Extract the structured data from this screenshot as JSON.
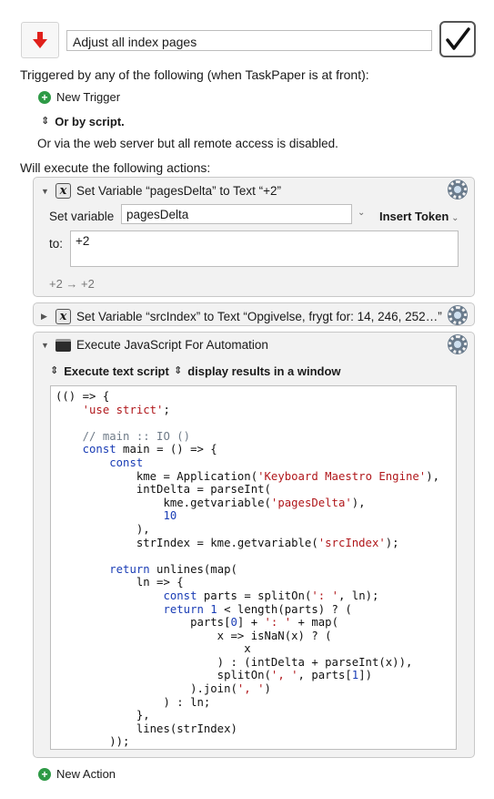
{
  "macro": {
    "name": "Adjust all index pages",
    "icon": "red-down-arrow-icon",
    "enabled_icon": "checkmark-icon"
  },
  "triggers": {
    "heading": "Triggered by any of the following (when TaskPaper is at front):",
    "new_trigger": "New Trigger",
    "by_script": "Or by script.",
    "web_server": "Or via the web server but all remote access is disabled."
  },
  "actions_heading": "Will execute the following actions:",
  "actions": [
    {
      "title": "Set Variable “pagesDelta” to Text “+2”",
      "set_variable_label": "Set variable",
      "variable_value": "pagesDelta",
      "insert_token": "Insert Token",
      "to_label": "to:",
      "to_value": "+2",
      "preview": "+2 → +2"
    },
    {
      "title": "Set Variable “srcIndex” to Text “Opgivelse, frygt for: 14, 246, 252…”"
    },
    {
      "title": "Execute JavaScript For Automation",
      "option1": "Execute text script",
      "option2": "display results in a window"
    }
  ],
  "new_action": "New Action",
  "colors": {
    "accent_green": "#2e9a46",
    "string_red": "#b0171b",
    "keyword_blue": "#1a3db5",
    "comment_gray": "#6f7b88"
  }
}
